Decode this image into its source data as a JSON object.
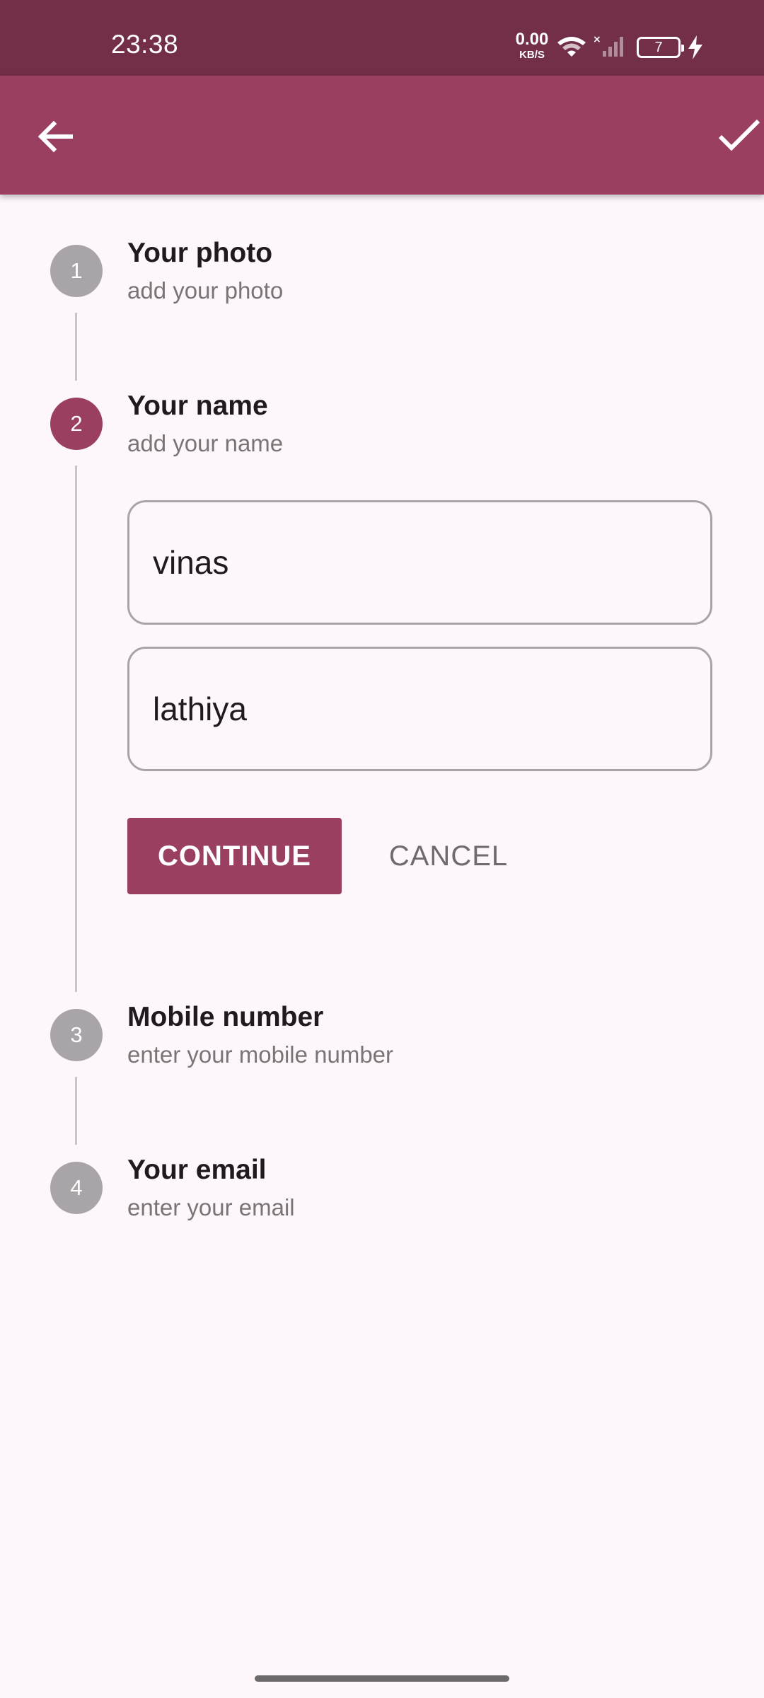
{
  "status_bar": {
    "time": "23:38",
    "net_speed_value": "0.00",
    "net_speed_unit": "KB/S",
    "battery_level": "7",
    "icons": [
      "wifi-icon",
      "signal-icon",
      "battery-icon",
      "charging-bolt-icon"
    ]
  },
  "app_bar": {
    "back_icon": "arrow-back-icon",
    "confirm_icon": "check-icon"
  },
  "colors": {
    "status_bar": "#732e49",
    "primary": "#9a3f62",
    "inactive_step": "#a8a4a7",
    "background": "#fdf7fb"
  },
  "steps": [
    {
      "number": "1",
      "title": "Your photo",
      "subtitle": "add your photo",
      "state": "inactive"
    },
    {
      "number": "2",
      "title": "Your name",
      "subtitle": "add your name",
      "state": "active"
    },
    {
      "number": "3",
      "title": "Mobile number",
      "subtitle": "enter your mobile number",
      "state": "inactive"
    },
    {
      "number": "4",
      "title": "Your email",
      "subtitle": "enter your email",
      "state": "inactive"
    }
  ],
  "name_form": {
    "first_name_value": "vinas",
    "last_name_value": "lathiya",
    "continue_label": "CONTINUE",
    "cancel_label": "CANCEL"
  }
}
